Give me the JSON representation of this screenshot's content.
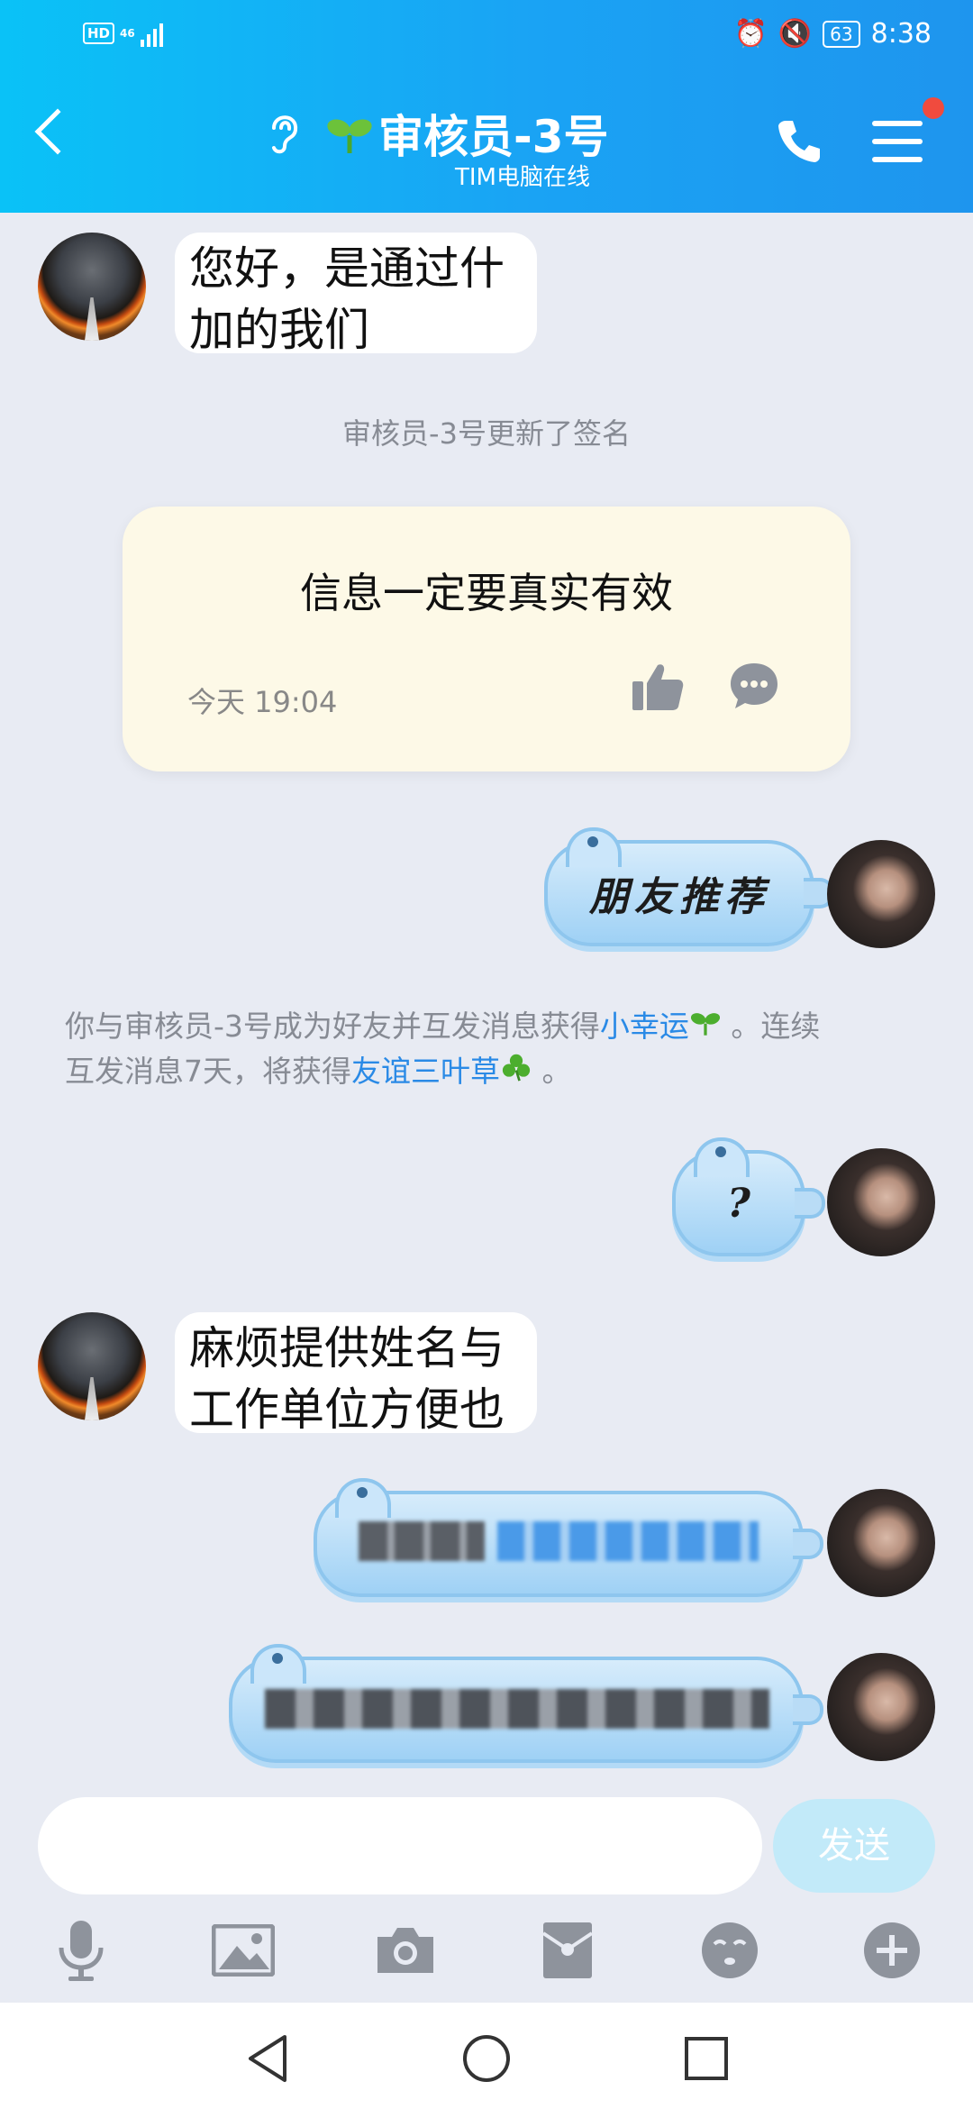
{
  "status_bar": {
    "hd": "HD",
    "network": "46",
    "battery": "63",
    "time": "8:38"
  },
  "header": {
    "title": "审核员-3号",
    "subtitle": "TIM电脑在线"
  },
  "messages": {
    "m1": {
      "lines": [
        "您好，是通过什",
        "加的我们"
      ]
    },
    "sys1": "审核员-3号更新了签名",
    "signature_card": {
      "text": "信息一定要真实有效",
      "time": "今天 19:04"
    },
    "m2": "朋友推荐",
    "notice": {
      "p1": "你与审核员-3号成为好友并互发消息获得",
      "link1": "小幸运",
      "p2": " 。连续",
      "p3": "互发消息7天，将获得",
      "link2": "友谊三叶草",
      "p4": " 。"
    },
    "m3": "?",
    "m4": {
      "lines": [
        "麻烦提供姓名与",
        "工作单位方便也"
      ]
    }
  },
  "composer": {
    "send_label": "发送"
  },
  "toolbar_icons": [
    "mic-icon",
    "image-icon",
    "camera-icon",
    "red-packet-icon",
    "emoji-icon",
    "plus-icon"
  ],
  "colors": {
    "header_start": "#0ac2f7",
    "header_end": "#1e95ee",
    "chat_bg": "#e8ebf3",
    "link": "#2a8ae6",
    "badge": "#f04b3e"
  }
}
